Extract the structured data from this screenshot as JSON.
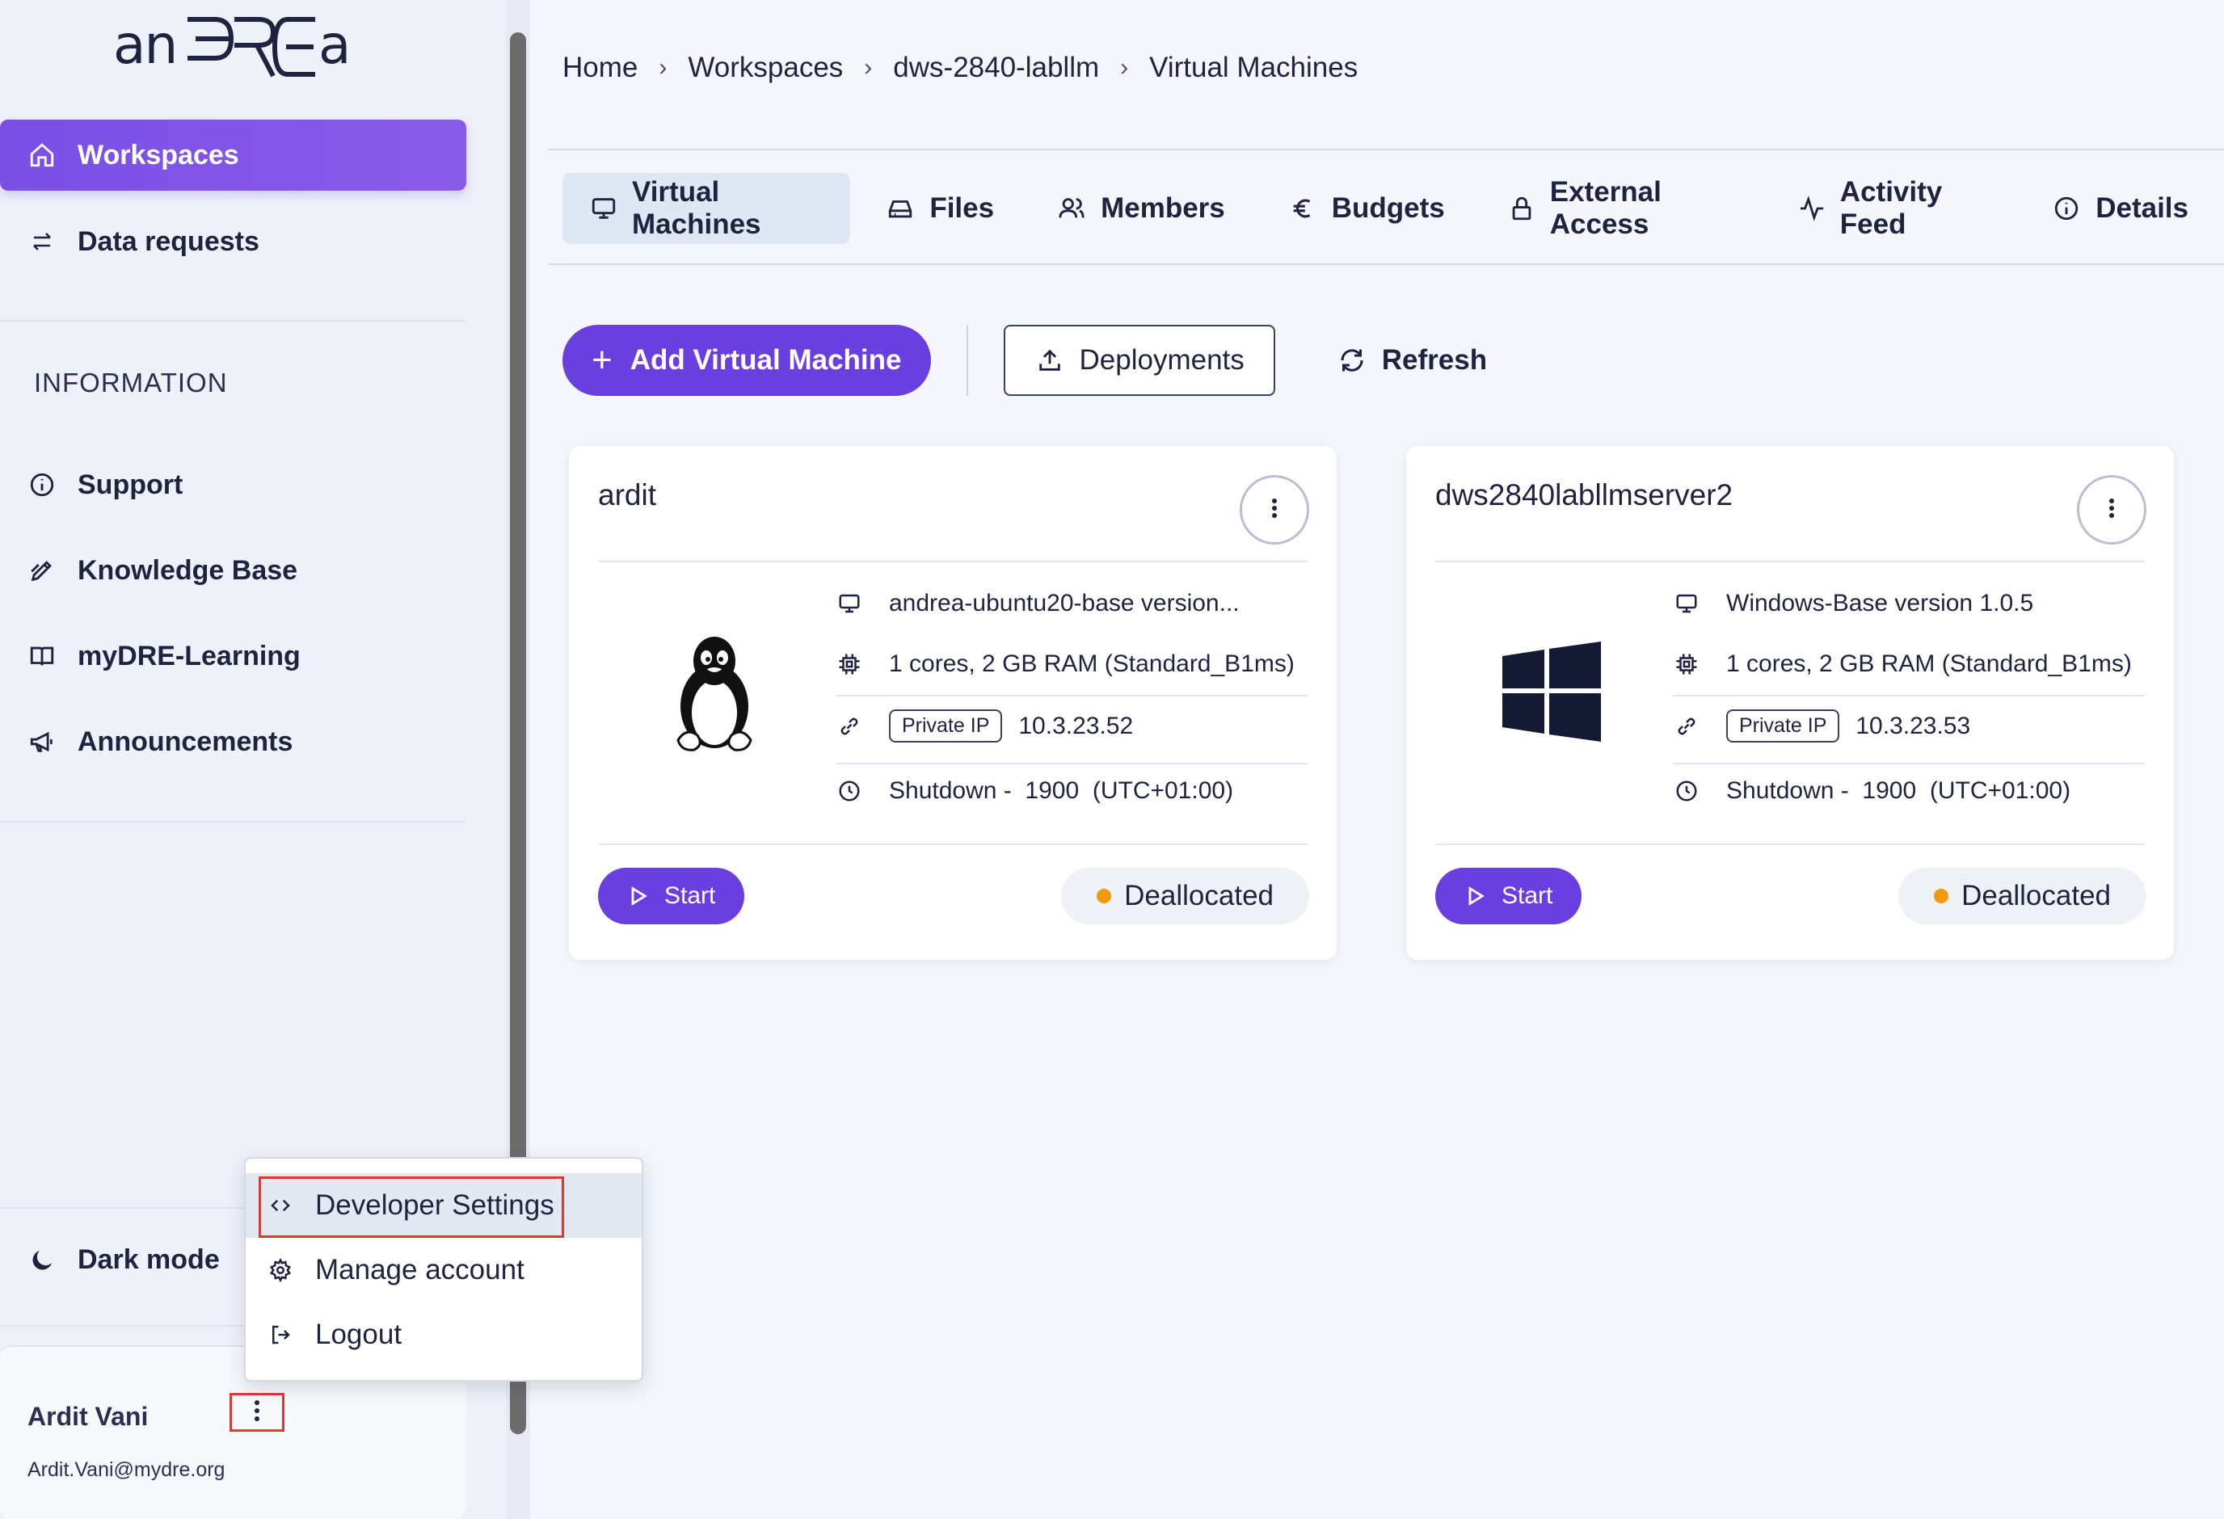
{
  "sidebar": {
    "logo_text": "anDREa",
    "nav": [
      {
        "label": "Workspaces",
        "icon": "home-icon",
        "active": true
      },
      {
        "label": "Data requests",
        "icon": "swap-arrows-icon",
        "active": false
      }
    ],
    "section_label": "INFORMATION",
    "info_items": [
      {
        "label": "Support",
        "icon": "info-circle-icon"
      },
      {
        "label": "Knowledge Base",
        "icon": "pen-icon"
      },
      {
        "label": "myDRE-Learning",
        "icon": "book-icon"
      },
      {
        "label": "Announcements",
        "icon": "megaphone-icon"
      }
    ],
    "dark_mode_label": "Dark mode",
    "user": {
      "name": "Ardit Vani",
      "email": "Ardit.Vani@mydre.org"
    }
  },
  "user_menu": {
    "items": [
      {
        "label": "Developer Settings",
        "icon": "code-icon",
        "highlighted": true
      },
      {
        "label": "Manage account",
        "icon": "gear-icon",
        "highlighted": false
      },
      {
        "label": "Logout",
        "icon": "logout-icon",
        "highlighted": false
      }
    ]
  },
  "breadcrumb": [
    "Home",
    "Workspaces",
    "dws-2840-labllm",
    "Virtual Machines"
  ],
  "tabs": [
    {
      "label": "Virtual Machines",
      "icon": "monitor-icon",
      "active": true
    },
    {
      "label": "Files",
      "icon": "drive-icon",
      "active": false
    },
    {
      "label": "Members",
      "icon": "users-icon",
      "active": false
    },
    {
      "label": "Budgets",
      "icon": "euro-icon",
      "active": false
    },
    {
      "label": "External Access",
      "icon": "lock-icon",
      "active": false
    },
    {
      "label": "Activity Feed",
      "icon": "activity-icon",
      "active": false
    },
    {
      "label": "Details",
      "icon": "info-circle-icon",
      "active": false
    }
  ],
  "actions": {
    "add_vm": "Add Virtual Machine",
    "deployments": "Deployments",
    "refresh": "Refresh"
  },
  "vms": [
    {
      "name": "ardit",
      "os_icon": "linux-penguin-icon",
      "image": "andrea-ubuntu20-base version...",
      "size": "1 cores, 2 GB RAM (Standard_B1ms)",
      "ip_label": "Private IP",
      "ip": "10.3.23.52",
      "shutdown": "Shutdown -  1900  (UTC+01:00)",
      "start_label": "Start",
      "status": "Deallocated",
      "status_color": "#f29a0c"
    },
    {
      "name": "dws2840labllmserver2",
      "os_icon": "windows-logo-icon",
      "image": "Windows-Base version 1.0.5",
      "size": "1 cores, 2 GB RAM (Standard_B1ms)",
      "ip_label": "Private IP",
      "ip": "10.3.23.53",
      "shutdown": "Shutdown -  1900  (UTC+01:00)",
      "start_label": "Start",
      "status": "Deallocated",
      "status_color": "#f29a0c"
    }
  ],
  "colors": {
    "accent": "#6a3fe0",
    "highlight": "#e2372f"
  }
}
